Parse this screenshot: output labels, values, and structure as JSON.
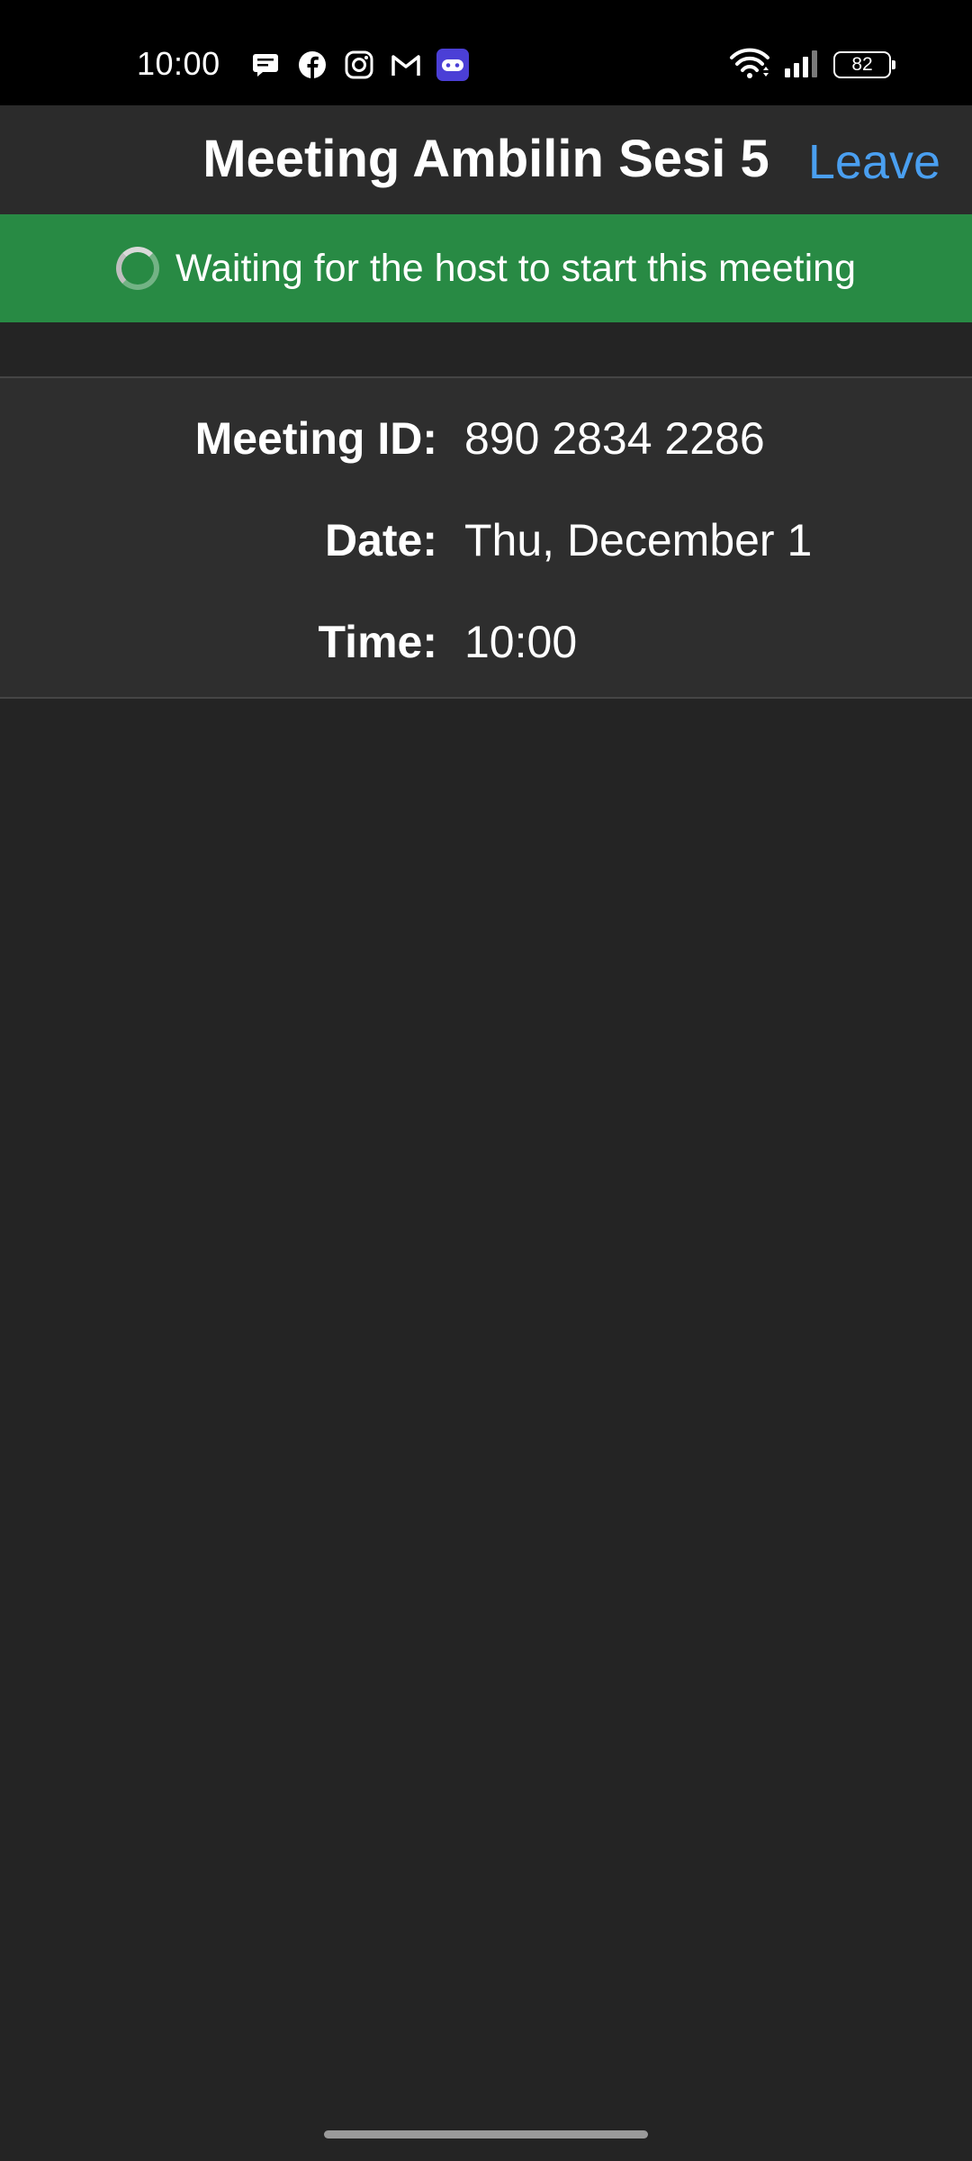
{
  "status_bar": {
    "time": "10:00",
    "notification_icons": [
      "message-icon",
      "facebook-icon",
      "instagram-icon",
      "gmail-icon",
      "game-icon"
    ],
    "battery_level": "82"
  },
  "header": {
    "title": "Meeting Ambilin Sesi 5",
    "leave_label": "Leave"
  },
  "banner": {
    "text": "Waiting for the host to start this meeting"
  },
  "meeting_info": {
    "id_label": "Meeting ID:",
    "id_value": "890 2834 2286",
    "date_label": "Date:",
    "date_value": "Thu, December 1",
    "time_label": "Time:",
    "time_value": "10:00"
  },
  "colors": {
    "background": "#242424",
    "banner_green": "#288a44",
    "leave_blue": "#4a9ff0"
  }
}
